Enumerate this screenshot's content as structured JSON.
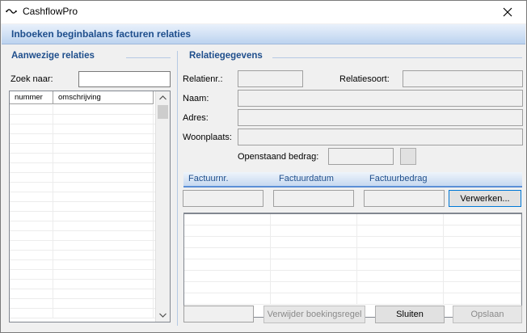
{
  "window": {
    "title": "CashflowPro"
  },
  "header": {
    "title": "Inboeken beginbalans facturen relaties"
  },
  "left": {
    "group_title": "Aanwezige relaties",
    "search_label": "Zoek naar:",
    "search_value": "",
    "columns": [
      "nummer",
      "omschrijving"
    ],
    "rows": [
      "",
      "",
      "",
      "",
      "",
      "",
      "",
      "",
      "",
      "",
      "",
      "",
      "",
      "",
      "",
      "",
      "",
      "",
      "",
      "",
      "",
      ""
    ]
  },
  "right": {
    "group_title": "Relatiegegevens",
    "relatienr_label": "Relatienr.:",
    "relatiesoort_label": "Relatiesoort:",
    "naam_label": "Naam:",
    "adres_label": "Adres:",
    "woonplaats_label": "Woonplaats:",
    "openstaand_label": "Openstaand bedrag:",
    "relatienr_value": "",
    "relatiesoort_value": "",
    "naam_value": "",
    "adres_value": "",
    "woonplaats_value": "",
    "openstaand_value": ""
  },
  "invoice_grid": {
    "headers": [
      "Factuurnr.",
      "Factuurdatum",
      "Factuurbedrag"
    ],
    "factuurnr_value": "",
    "factuurdatum_value": "",
    "factuurbedrag_value": "",
    "process_button": "Verwerken...",
    "rows": [
      "",
      "",
      "",
      "",
      "",
      "",
      "",
      ""
    ]
  },
  "footer": {
    "status_value": "",
    "delete_button": "Verwijder boekingsregel",
    "close_button": "Sluiten",
    "save_button": "Opslaan"
  }
}
